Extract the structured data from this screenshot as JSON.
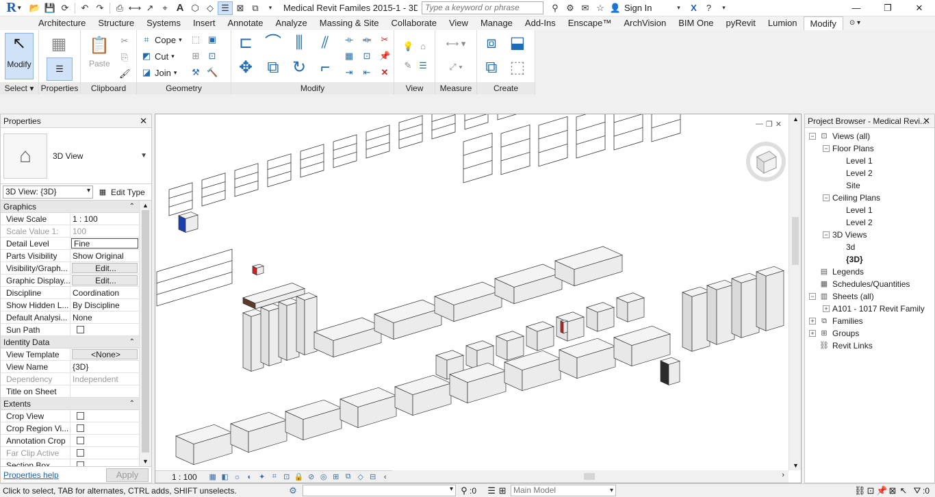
{
  "app": {
    "title": "Medical Revit Familes 2015-1 - 3D ...",
    "search_placeholder": "Type a keyword or phrase",
    "sign_in": "Sign In",
    "accent": "#1e5aa8"
  },
  "tabs": [
    "Architecture",
    "Structure",
    "Systems",
    "Insert",
    "Annotate",
    "Analyze",
    "Massing & Site",
    "Collaborate",
    "View",
    "Manage",
    "Add-Ins",
    "Enscape™",
    "ArchVision",
    "BIM One",
    "pyRevit",
    "Lumion",
    "Modify"
  ],
  "ribbon": {
    "select": {
      "button": "Modify",
      "label": "Select"
    },
    "properties": {
      "label": "Properties"
    },
    "clipboard": {
      "paste": "Paste",
      "label": "Clipboard"
    },
    "geometry": {
      "cope": "Cope",
      "cut": "Cut",
      "join": "Join",
      "label": "Geometry"
    },
    "modify": {
      "label": "Modify"
    },
    "view": {
      "label": "View"
    },
    "measure": {
      "label": "Measure"
    },
    "create": {
      "label": "Create"
    }
  },
  "properties": {
    "title": "Properties",
    "type_name": "3D View",
    "instance": "3D View: {3D}",
    "edit_type": "Edit Type",
    "groups": [
      {
        "name": "Graphics",
        "rows": [
          {
            "k": "View Scale",
            "v": "1 : 100"
          },
          {
            "k": "Scale Value    1:",
            "v": "100",
            "dis": true
          },
          {
            "k": "Detail Level",
            "v": "Fine",
            "boxed": true
          },
          {
            "k": "Parts Visibility",
            "v": "Show Original"
          },
          {
            "k": "Visibility/Graph...",
            "v": "Edit...",
            "btn": true
          },
          {
            "k": "Graphic Display...",
            "v": "Edit...",
            "btn": true
          },
          {
            "k": "Discipline",
            "v": "Coordination"
          },
          {
            "k": "Show Hidden L...",
            "v": "By Discipline"
          },
          {
            "k": "Default Analysi...",
            "v": "None"
          },
          {
            "k": "Sun Path",
            "v": "",
            "chk": true
          }
        ]
      },
      {
        "name": "Identity Data",
        "rows": [
          {
            "k": "View Template",
            "v": "<None>",
            "btn": true
          },
          {
            "k": "View Name",
            "v": "{3D}"
          },
          {
            "k": "Dependency",
            "v": "Independent",
            "dis": true
          },
          {
            "k": "Title on Sheet",
            "v": ""
          }
        ]
      },
      {
        "name": "Extents",
        "rows": [
          {
            "k": "Crop View",
            "v": "",
            "chk": true
          },
          {
            "k": "Crop Region Vi...",
            "v": "",
            "chk": true
          },
          {
            "k": "Annotation Crop",
            "v": "",
            "chk": true
          },
          {
            "k": "Far Clip Active",
            "v": "",
            "chk": true,
            "dis": true
          },
          {
            "k": "Section Box",
            "v": "",
            "chk": true
          }
        ]
      }
    ],
    "help": "Properties help",
    "apply": "Apply"
  },
  "canvas": {
    "scale": "1 : 100"
  },
  "browser": {
    "title": "Project Browser - Medical Revi...",
    "nodes": [
      {
        "label": "Views (all)",
        "level": 0,
        "toggle": "−",
        "icon": "views"
      },
      {
        "label": "Floor Plans",
        "level": 1,
        "toggle": "−"
      },
      {
        "label": "Level 1",
        "level": 2
      },
      {
        "label": "Level 2",
        "level": 2
      },
      {
        "label": "Site",
        "level": 2
      },
      {
        "label": "Ceiling Plans",
        "level": 1,
        "toggle": "−"
      },
      {
        "label": "Level 1",
        "level": 2
      },
      {
        "label": "Level 2",
        "level": 2
      },
      {
        "label": "3D Views",
        "level": 1,
        "toggle": "−"
      },
      {
        "label": "3d",
        "level": 2
      },
      {
        "label": "{3D}",
        "level": 2,
        "bold": true
      },
      {
        "label": "Legends",
        "level": 0,
        "icon": "legend"
      },
      {
        "label": "Schedules/Quantities",
        "level": 0,
        "icon": "schedule"
      },
      {
        "label": "Sheets (all)",
        "level": 0,
        "toggle": "−",
        "icon": "sheet"
      },
      {
        "label": "A101 - 1017 Revit Family",
        "level": 1,
        "toggle": "+"
      },
      {
        "label": "Families",
        "level": 0,
        "toggle": "+",
        "icon": "family"
      },
      {
        "label": "Groups",
        "level": 0,
        "toggle": "+",
        "icon": "group"
      },
      {
        "label": "Revit Links",
        "level": 0,
        "icon": "link"
      }
    ]
  },
  "status": {
    "message": "Click to select, TAB for alternates, CTRL adds, SHIFT unselects.",
    "count": ":0",
    "model": "Main Model",
    "filter_count": ":0"
  }
}
